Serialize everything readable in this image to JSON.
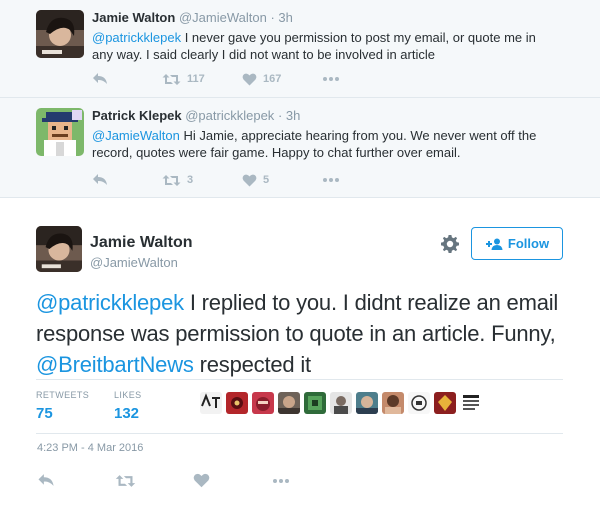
{
  "reply1": {
    "name": "Jamie Walton",
    "handle": "@JamieWalton",
    "time": "· 3h",
    "mention": "@patrickklepek",
    "text": " I never gave you permission to post my email, or quote me in any way. I said clearly I did not want to be involved in article",
    "retweets": "117",
    "likes": "167"
  },
  "reply2": {
    "name": "Patrick Klepek",
    "handle": "@patrickklepek",
    "time": "· 3h",
    "mention": "@JamieWalton",
    "text": " Hi Jamie, appreciate hearing from you. We never went off the record, quotes were fair game. Happy to chat further over email.",
    "retweets": "3",
    "likes": "5"
  },
  "main": {
    "name": "Jamie Walton",
    "handle": "@JamieWalton",
    "follow_label": "Follow",
    "mention1": "@patrickklepek",
    "text1": " I replied to you. I didnt realize an email response was permission to quote in an article. Funny, ",
    "mention2": "@BreitbartNews",
    "text2": " respected it",
    "retweets_label": "RETWEETS",
    "retweets": "75",
    "likes_label": "LIKES",
    "likes": "132",
    "timestamp": "4:23 PM - 4 Mar 2016"
  },
  "icons": [
    "reply-icon",
    "retweet-icon",
    "like-icon",
    "more-icon",
    "gear-icon",
    "follow-person-icon"
  ],
  "colors": {
    "link": "#1b95e0",
    "muted": "#8899a6",
    "icon": "#aab8c2",
    "reply_bg": "#f5f8fa"
  }
}
